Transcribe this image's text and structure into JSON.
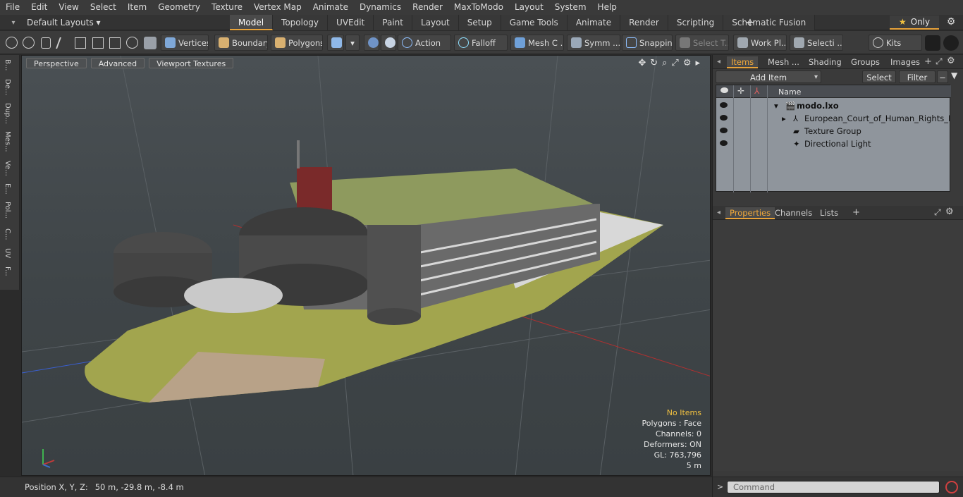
{
  "menu": [
    "File",
    "Edit",
    "View",
    "Select",
    "Item",
    "Geometry",
    "Texture",
    "Vertex Map",
    "Animate",
    "Dynamics",
    "Render",
    "MaxToModo",
    "Layout",
    "System",
    "Help"
  ],
  "layout": {
    "selector_label": "Default Layouts ▾"
  },
  "tabs": [
    "Model",
    "Topology",
    "UVEdit",
    "Paint",
    "Layout",
    "Setup",
    "Game Tools",
    "Animate",
    "Render",
    "Scripting",
    "Schematic Fusion"
  ],
  "only_label": "Only",
  "toolbar": {
    "vertices": "Vertices",
    "boundary": "Boundary",
    "polygons": "Polygons",
    "action": "Action",
    "falloff": "Falloff",
    "mesh_c": "Mesh C ...",
    "symm": "Symm ...",
    "snapping": "Snapping",
    "select_t": "Select T...",
    "work_pl": "Work Pl...",
    "selecti": "Selecti ...",
    "kits": "Kits"
  },
  "viewport": {
    "tabs": [
      "Perspective",
      "Advanced",
      "Viewport Textures"
    ],
    "info": {
      "status": "No Items",
      "polygons": "Polygons : Face",
      "channels": "Channels: 0",
      "deformers": "Deformers: ON",
      "gl": "GL: 763,796",
      "scale": "5 m"
    }
  },
  "left_strip": [
    "B...",
    "De...",
    "Dup...",
    "Mes...",
    "Ve...",
    "E...",
    "Pol...",
    "C...",
    "UV",
    "F..."
  ],
  "status": {
    "label": "Position X, Y, Z:",
    "value": "50 m, -29.8 m, -8.4 m"
  },
  "panel": {
    "top_tabs": [
      "Items",
      "Mesh ...",
      "Shading",
      "Groups",
      "Images"
    ],
    "add_item": "Add Item",
    "select": "Select",
    "filter": "Filter",
    "name_header": "Name",
    "items": [
      {
        "name": "modo.lxo"
      },
      {
        "name": "European_Court_of_Human_Rights_Buil..."
      },
      {
        "name": "Texture Group"
      },
      {
        "name": "Directional Light"
      }
    ],
    "bottom_tabs": [
      "Properties",
      "Channels",
      "Lists"
    ],
    "command_placeholder": "Command"
  },
  "colors": {
    "accent": "#e8a33a",
    "warn_text": "#f0c040"
  }
}
